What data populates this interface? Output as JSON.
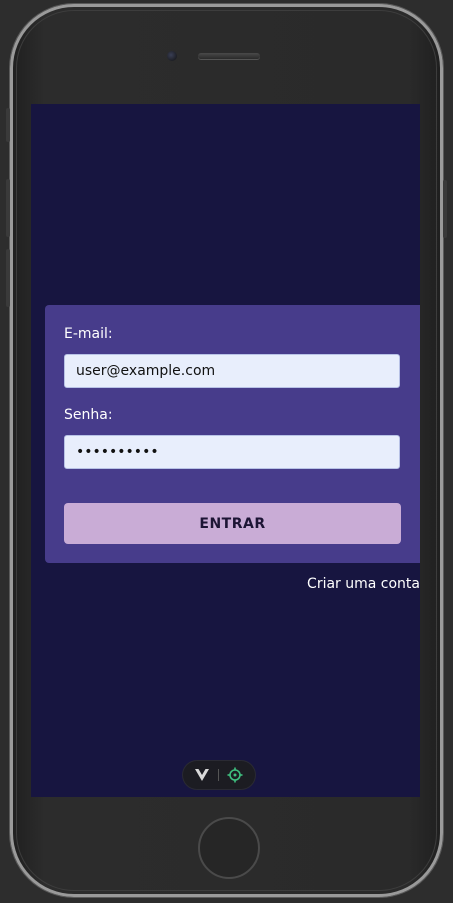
{
  "login_form": {
    "email_label": "E-mail:",
    "email_value": "user@example.com",
    "password_label": "Senha:",
    "password_value": "password12",
    "submit_label": "ENTRAR"
  },
  "signup_link_label": "Criar uma conta",
  "devtools": {
    "left_icon": "vue-logo-icon",
    "right_icon": "crosshair-icon"
  },
  "colors": {
    "screen_background": "#171540",
    "card_background": "#473c8b",
    "input_background": "#e8eefc",
    "button_background": "#c9acd6",
    "button_text": "#1d1535"
  }
}
